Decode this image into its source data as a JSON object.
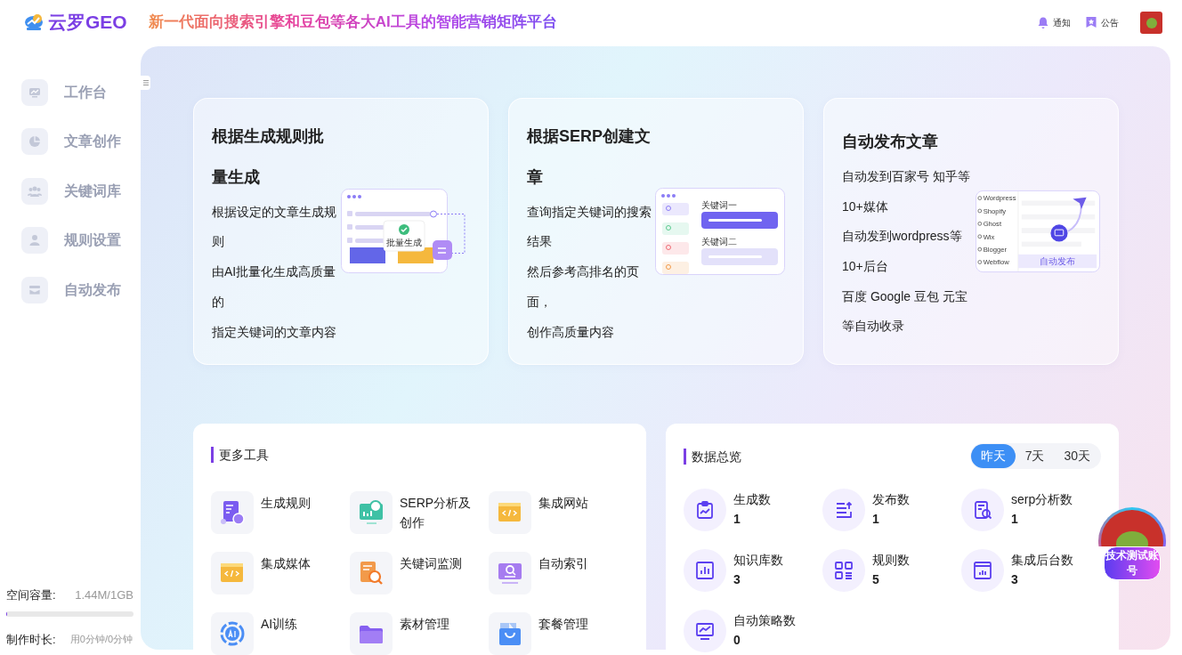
{
  "header": {
    "brand": "云罗GEO",
    "tagline": "新一代面向搜索引擎和豆包等各大AI工具的智能营销矩阵平台",
    "actions": [
      {
        "label": "通知"
      },
      {
        "label": "公告"
      }
    ]
  },
  "sidebar": {
    "items": [
      {
        "label": "工作台"
      },
      {
        "label": "文章创作"
      },
      {
        "label": "关键词库"
      },
      {
        "label": "规则设置"
      },
      {
        "label": "自动发布"
      }
    ],
    "storage": {
      "label": "空间容量:",
      "value": "1.44M/1GB",
      "level": 0.001
    },
    "duration": {
      "label": "制作时长:",
      "value": "用0分钟/0分钟"
    }
  },
  "feature_cards": [
    {
      "title": "根据生成规则批量生成",
      "lines": [
        "根据设定的文章生成规则",
        "由AI批量化生成高质量的",
        "指定关键词的文章内容"
      ],
      "illustration": {
        "kind": "batch",
        "labels": [
          "批量生成"
        ]
      }
    },
    {
      "title": "根据SERP创建文章",
      "lines": [
        "查询指定关键词的搜索结果",
        "然后参考高排名的页面，",
        "创作高质量内容"
      ],
      "illustration": {
        "kind": "serp",
        "labels": [
          "关键词一",
          "关键词二"
        ]
      }
    },
    {
      "title": "自动发布文章",
      "lines": [
        "自动发到百家号 知乎等10+媒体",
        "自动发到wordpress等10+后台",
        "百度 Google 豆包 元宝等自动收录"
      ],
      "illustration": {
        "kind": "publish",
        "labels": [
          "Wordpress",
          "Shopify",
          "Ghost",
          "Wix",
          "Blogger",
          "Webflow",
          "自动发布"
        ]
      }
    }
  ],
  "tools": {
    "title": "更多工具",
    "items": [
      {
        "label": "生成规则"
      },
      {
        "label": "SERP分析及创作"
      },
      {
        "label": "集成网站"
      },
      {
        "label": "集成媒体"
      },
      {
        "label": "关键词监测"
      },
      {
        "label": "自动索引"
      },
      {
        "label": "AI训练"
      },
      {
        "label": "素材管理"
      },
      {
        "label": "套餐管理"
      }
    ]
  },
  "overview": {
    "title": "数据总览",
    "ranges": [
      {
        "label": "昨天",
        "selected": true
      },
      {
        "label": "7天",
        "selected": false
      },
      {
        "label": "30天",
        "selected": false
      }
    ],
    "stats": [
      {
        "label": "生成数",
        "value": "1"
      },
      {
        "label": "发布数",
        "value": "1"
      },
      {
        "label": "serp分析数",
        "value": "1"
      },
      {
        "label": "知识库数",
        "value": "3"
      },
      {
        "label": "规则数",
        "value": "5"
      },
      {
        "label": "集成后台数",
        "value": "3"
      },
      {
        "label": "自动策略数",
        "value": "0"
      }
    ]
  },
  "account_badge": {
    "label": "技术测试账号"
  }
}
